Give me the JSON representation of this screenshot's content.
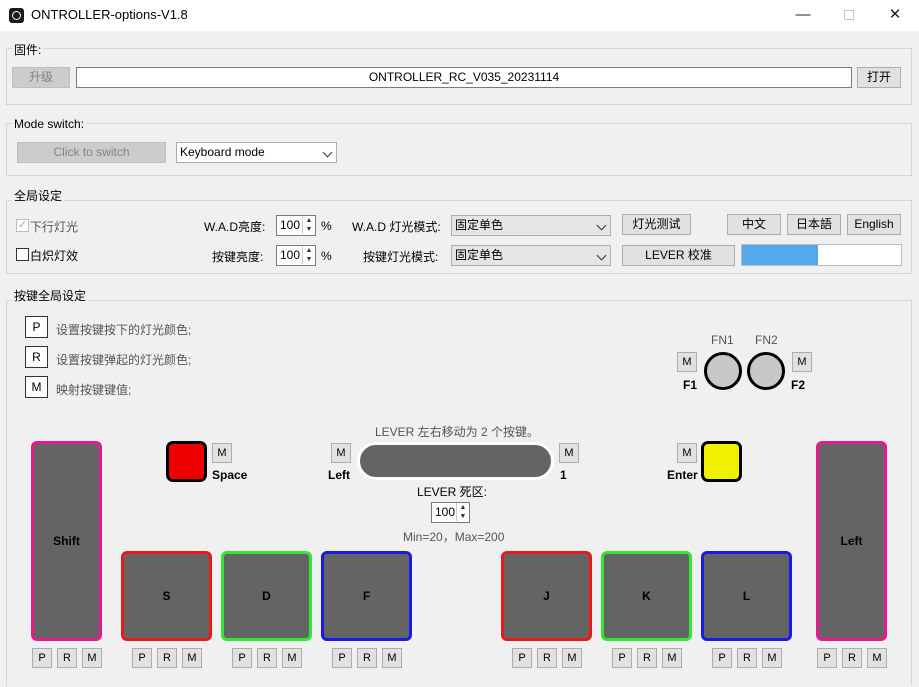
{
  "window": {
    "title": "ONTROLLER-options-V1.8",
    "min": "—",
    "close": "✕"
  },
  "firmware": {
    "group_label": "固件:",
    "upgrade_label": "升级",
    "version": "ONTROLLER_RC_V035_20231114",
    "open_label": "打开"
  },
  "mode": {
    "group_label": "Mode switch:",
    "switch_label": "Click to switch",
    "selected": "Keyboard mode"
  },
  "global": {
    "group_label": "全局设定",
    "down_light_label": "下行灯光",
    "down_light_checked": true,
    "incandescent_label": "白炽灯效",
    "incandescent_checked": false,
    "wad_brightness_label": "W.A.D亮度:",
    "wad_brightness_value": "100",
    "key_brightness_label": "按键亮度:",
    "key_brightness_value": "100",
    "percent": "%",
    "wad_light_mode_label": "W.A.D 灯光模式:",
    "wad_light_mode_value": "固定单色",
    "key_light_mode_label": "按键灯光模式:",
    "key_light_mode_value": "固定单色",
    "light_test_label": "灯光测试",
    "lever_calib_label": "LEVER 校准",
    "lang_zh": "中文",
    "lang_ja": "日本語",
    "lang_en": "English",
    "progress_fraction": 0.48,
    "progress_color": "#56a8ec"
  },
  "keys_global": {
    "group_label": "按键全局设定",
    "legend": [
      {
        "key": "P",
        "text": "设置按键按下的灯光颜色;"
      },
      {
        "key": "R",
        "text": "设置按键弹起的灯光颜色;"
      },
      {
        "key": "M",
        "text": "映射按键键值;"
      }
    ],
    "fn1": "FN1",
    "fn2": "FN2",
    "f1": "F1",
    "f2": "F2",
    "m": "M",
    "p": "P",
    "r": "R",
    "lever_hint": "LEVER 左右移动为 2 个按键。",
    "lever_left": "Left",
    "lever_right": "1",
    "space_label": "Space",
    "enter_label": "Enter",
    "deadzone_label": "LEVER 死区:",
    "deadzone_value": "100",
    "deadzone_range": "Min=20，Max=200",
    "space_color": "#ee0000",
    "enter_color": "#f0f000",
    "keys": [
      {
        "label": "Shift",
        "color": "#e8198b"
      },
      {
        "label": "S",
        "color": "#e61a1a"
      },
      {
        "label": "D",
        "color": "#33e633"
      },
      {
        "label": "F",
        "color": "#1a1ae6"
      },
      {
        "label": "J",
        "color": "#e61a1a"
      },
      {
        "label": "K",
        "color": "#33e633"
      },
      {
        "label": "L",
        "color": "#1a1ae6"
      },
      {
        "label": "Left",
        "color": "#e8198b"
      }
    ]
  }
}
